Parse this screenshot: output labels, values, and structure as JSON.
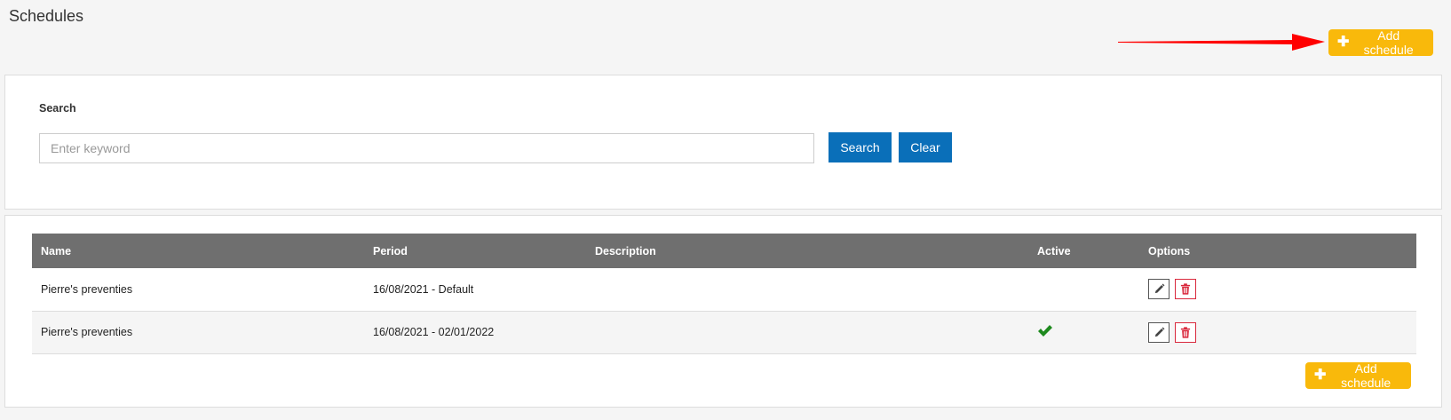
{
  "page": {
    "title": "Schedules"
  },
  "actions": {
    "add_schedule_label": "Add schedule"
  },
  "search": {
    "label": "Search",
    "placeholder": "Enter keyword",
    "value": "",
    "search_button": "Search",
    "clear_button": "Clear"
  },
  "table": {
    "columns": [
      "Name",
      "Period",
      "Description",
      "Active",
      "Options"
    ],
    "rows": [
      {
        "name": "Pierre's preventies",
        "period": "16/08/2021 - Default",
        "description": "",
        "active": false
      },
      {
        "name": "Pierre's preventies",
        "period": "16/08/2021 - 02/01/2022",
        "description": "",
        "active": true
      }
    ]
  },
  "icons": {
    "add": "plus-icon",
    "edit": "pencil-icon",
    "delete": "trash-icon",
    "active": "checkmark-icon",
    "annotation": "red-arrow"
  },
  "colors": {
    "accent": "#f9b90b",
    "primary": "#0a6fb9",
    "header": "#6f6f6f",
    "danger": "#d9283c",
    "success": "#1e8a1e",
    "annotation": "#ff0000"
  }
}
